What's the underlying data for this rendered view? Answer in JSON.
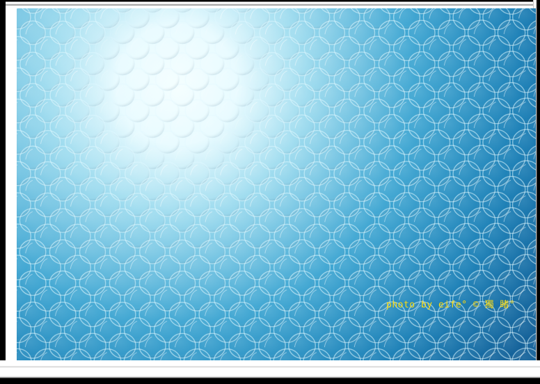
{
  "photo": {
    "subject": "bubble wrap",
    "colors": {
      "highlight": "#f2fdff",
      "mid": "#5fc3e4",
      "deep": "#0f6fa6",
      "bubble_edge": "#dff7ff",
      "frame": "#000000",
      "watermark": "#ffe31a"
    }
  },
  "watermark": {
    "text": "photo by eife° © 獨 睹°"
  }
}
